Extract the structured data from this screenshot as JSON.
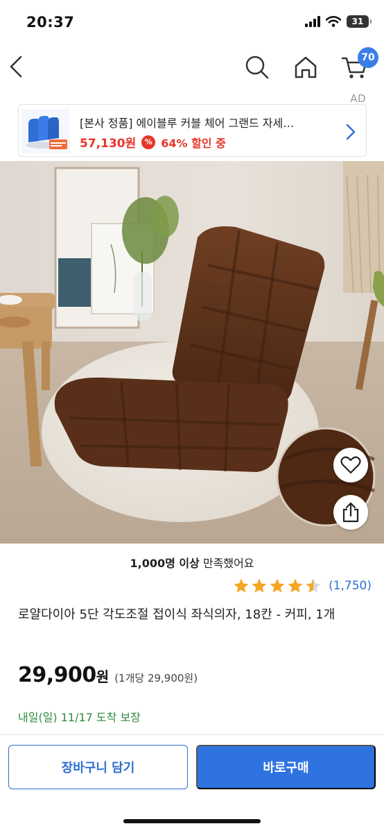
{
  "status_bar": {
    "time": "20:37",
    "battery": "31"
  },
  "nav": {
    "cart_count": "70"
  },
  "ad": {
    "label": "AD",
    "title": "[본사 정품] 에이블루 커블 체어 그랜드 자세…",
    "price": "57,130원",
    "discount_icon": "%",
    "discount": "64% 할인 중"
  },
  "product": {
    "satisfaction_bold": "1,000명 이상",
    "satisfaction_rest": " 만족했어요",
    "rating": 4.5,
    "rating_count": "(1,750)",
    "title": "로얄다이아 5단 각도조절 접이식 좌식의자, 18칸 - 커피, 1개",
    "price_number": "29,900",
    "price_won": "원",
    "unit_price": "(1개당 29,900원)",
    "delivery": "내일(일) 11/17 도착 보장"
  },
  "actions": {
    "cart": "장바구니 담기",
    "buy": "바로구매"
  },
  "colors": {
    "accent": "#2f73e0",
    "sale": "#e8352a",
    "delivery": "#2e8b3e",
    "star": "#f5a623"
  }
}
